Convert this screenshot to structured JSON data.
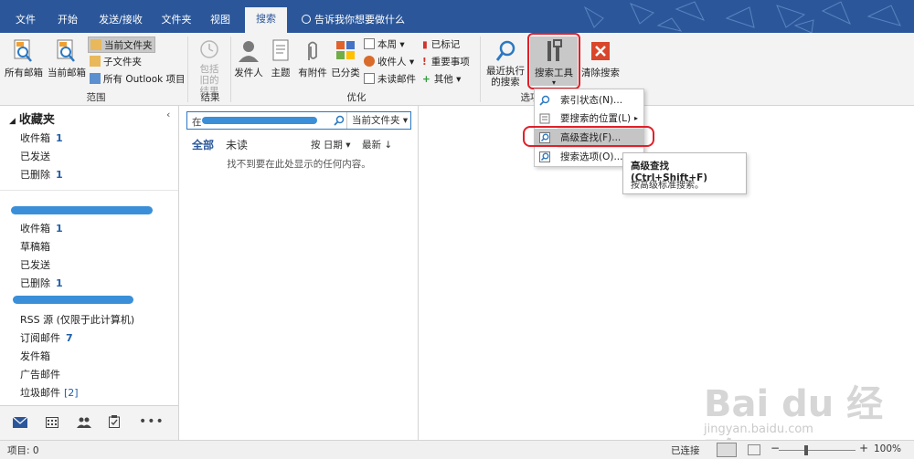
{
  "tabs": [
    "文件",
    "开始",
    "发送/接收",
    "文件夹",
    "视图",
    "搜索"
  ],
  "active_tab": "搜索",
  "tell_me": "告诉我你想要做什么",
  "ribbon": {
    "scope": {
      "all_mailboxes": "所有邮箱",
      "current_mailbox": "当前邮箱",
      "current_folder": "当前文件夹",
      "subfolders": "子文件夹",
      "all_outlook_items": "所有 Outlook 项目",
      "group_label": "范围"
    },
    "results": {
      "include_older": "包括旧的结果",
      "group_label": "结果"
    },
    "refine": {
      "from": "发件人",
      "subject": "主题",
      "has_attachments": "有附件",
      "categorized": "已分类",
      "this_week": "本周",
      "sent_to": "收件人",
      "unread": "未读邮件",
      "flagged": "已标记",
      "important": "重要事项",
      "more": "其他",
      "group_label": "优化"
    },
    "options": {
      "recent_searches": "最近执行的搜索",
      "search_tools": "搜索工具",
      "close_search": "清除搜索",
      "group_label": "选项"
    }
  },
  "folders": {
    "favorites": "收藏夹",
    "fav_items": [
      {
        "label": "收件箱",
        "count": "1"
      },
      {
        "label": "已发送",
        "count": ""
      },
      {
        "label": "已删除",
        "count": "1"
      }
    ],
    "account1_items": [
      {
        "label": "收件箱",
        "count": "1"
      },
      {
        "label": "草稿箱",
        "count": ""
      },
      {
        "label": "已发送",
        "count": ""
      },
      {
        "label": "已删除",
        "count": "1"
      }
    ],
    "account2_items": [
      {
        "label": "RSS 源 (仅限于此计算机)",
        "count": ""
      },
      {
        "label": "订阅邮件",
        "count": "7"
      },
      {
        "label": "发件箱",
        "count": ""
      },
      {
        "label": "广告邮件",
        "count": ""
      },
      {
        "label": "垃圾邮件",
        "count": "[2]"
      }
    ]
  },
  "message_list": {
    "search_prefix": "在",
    "search_scope": "当前文件夹",
    "filter_all": "全部",
    "filter_unread": "未读",
    "sort_by": "按 日期",
    "sort_order": "最新 ↓",
    "empty_text": "找不到要在此处显示的任何内容。"
  },
  "menu": {
    "items": [
      "索引状态(N)...",
      "要搜索的位置(L)",
      "高级查找(F)...",
      "搜索选项(O)..."
    ],
    "hover_index": 2
  },
  "tooltip": {
    "title": "高级查找 (Ctrl+Shift+F)",
    "description": "按高级标准搜索。"
  },
  "status": {
    "items": "项目: 0",
    "connection": "已连接",
    "zoom": "100%"
  },
  "watermark": {
    "logo": "Bai du 经验",
    "url": "jingyan.baidu.com"
  },
  "colors": {
    "brand": "#2b579a",
    "highlight_ring": "#e0202a",
    "unread_count": "#1f5fa8"
  }
}
